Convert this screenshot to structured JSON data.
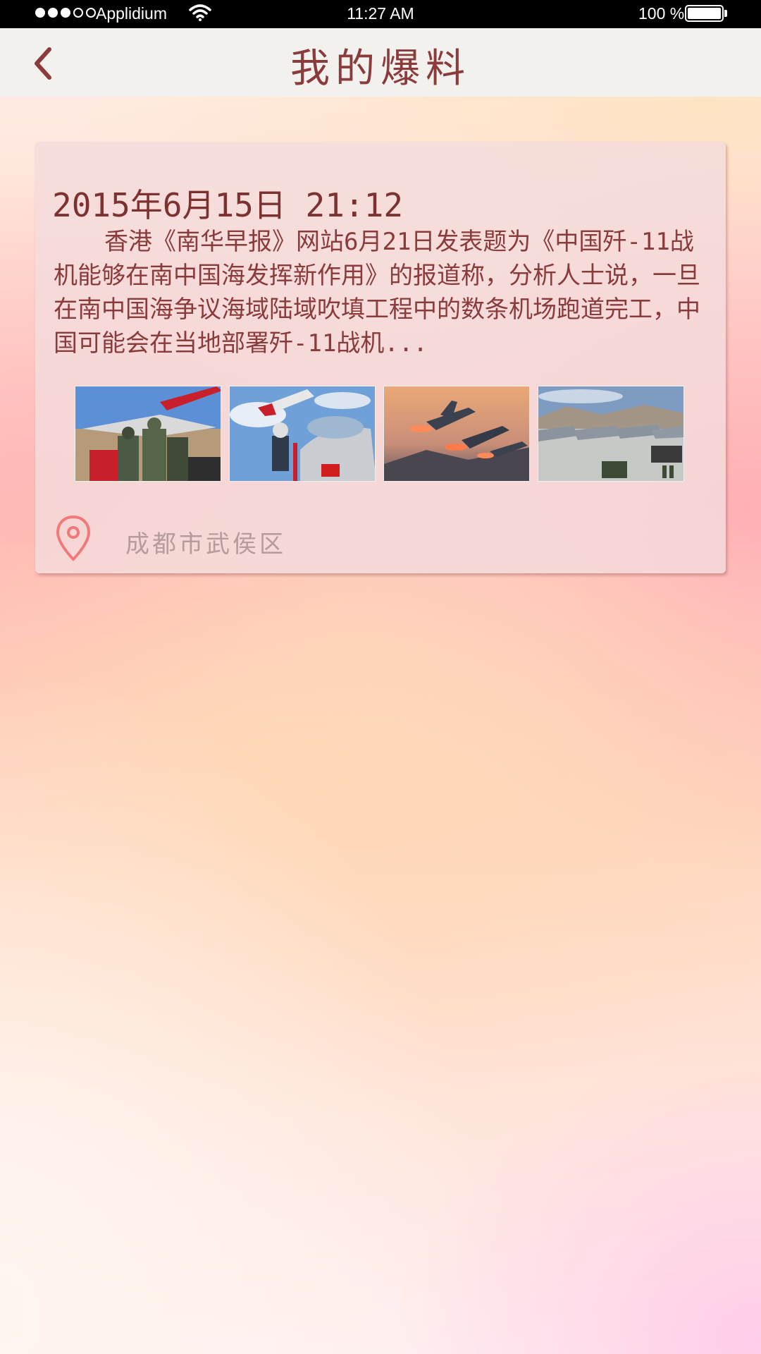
{
  "status_bar": {
    "carrier": "Applidium",
    "time": "11:27 AM",
    "battery": "100 %",
    "signal_icon": "signal-dots-icon",
    "wifi_icon": "wifi-icon",
    "battery_icon": "battery-icon"
  },
  "nav": {
    "title": "我的爆料",
    "back_icon": "chevron-left-icon"
  },
  "post": {
    "date": "2015年6月15日 21:12",
    "body": "香港《南华早报》网站6月21日发表题为《中国歼-11战机能够在南中国海发挥新作用》的报道称，分析人士说，一旦在南中国海争议海域陆域吹填工程中的数条机场跑道完工，中国可能会在当地部署歼-11战机...",
    "images": [
      {
        "name": "soldiers-loading-missile",
        "icon": "photo-icon"
      },
      {
        "name": "pilot-boarding-cockpit",
        "icon": "photo-icon"
      },
      {
        "name": "jets-takeoff-sunset",
        "icon": "photo-icon"
      },
      {
        "name": "airfield-with-jets",
        "icon": "photo-icon"
      }
    ],
    "location": "成都市武侯区",
    "location_icon": "map-pin-icon"
  },
  "colors": {
    "title": "#8a3b3b",
    "pin": "#f07a7a",
    "location_text": "#b59b9b"
  }
}
